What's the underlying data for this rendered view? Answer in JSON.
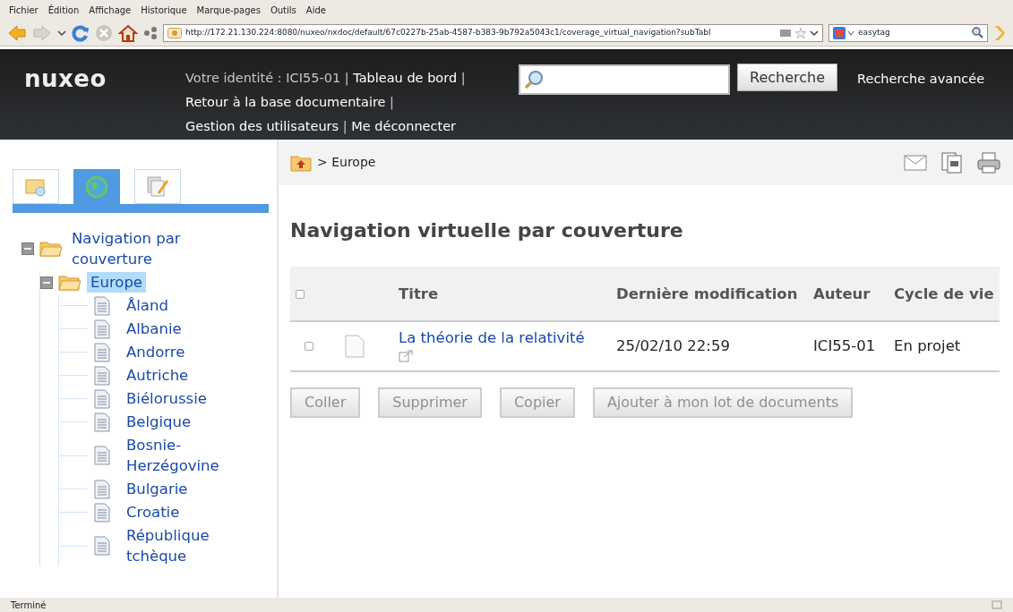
{
  "menu": [
    "Fichier",
    "Édition",
    "Affichage",
    "Historique",
    "Marque-pages",
    "Outils",
    "Aide"
  ],
  "browser": {
    "url": "http://172.21.130.224:8080/nuxeo/nxdoc/default/67c0227b-25ab-4587-b383-9b792a5043c1/coverage_virtual_navigation?subTabl",
    "search_value": "easytag"
  },
  "header": {
    "logo": "nuxeo",
    "identity": "Votre identité : ICI55-01",
    "separator": "|",
    "links": [
      "Tableau de bord",
      "Retour à la base documentaire",
      "Gestion des utilisateurs",
      "Me déconnecter"
    ],
    "search_button": "Recherche",
    "advanced_search": "Recherche avancée"
  },
  "sidebar": {
    "tabs": [
      {
        "kind": "search",
        "selected": false
      },
      {
        "kind": "globe",
        "selected": true
      },
      {
        "kind": "clipboard",
        "selected": false
      }
    ],
    "tree": [
      {
        "label": "Navigation par couverture",
        "kind": "folder",
        "expanded": true,
        "selected": false,
        "children": [
          {
            "label": "Europe",
            "kind": "folder",
            "expanded": true,
            "selected": true,
            "children": [
              {
                "label": "Åland",
                "kind": "document",
                "selected": false
              },
              {
                "label": "Albanie",
                "kind": "document",
                "selected": false
              },
              {
                "label": "Andorre",
                "kind": "document",
                "selected": false
              },
              {
                "label": "Autriche",
                "kind": "document",
                "selected": false
              },
              {
                "label": "Biélorussie",
                "kind": "document",
                "selected": false
              },
              {
                "label": "Belgique",
                "kind": "document",
                "selected": false
              },
              {
                "label": "Bosnie-Herzégovine",
                "kind": "document",
                "selected": false
              },
              {
                "label": "Bulgarie",
                "kind": "document",
                "selected": false
              },
              {
                "label": "Croatie",
                "kind": "document",
                "selected": false
              },
              {
                "label": "République tchèque",
                "kind": "document",
                "selected": false
              }
            ]
          }
        ]
      }
    ]
  },
  "breadcrumb": "> Europe",
  "page_title": "Navigation virtuelle par couverture",
  "table": {
    "select_all_checked": false,
    "columns": [
      "Titre",
      "Dernière modification",
      "Auteur",
      "Cycle de vie"
    ],
    "rows": [
      {
        "checked": false,
        "title": "La théorie de la relativité",
        "modified": "25/02/10 22:59",
        "author": "ICI55-01",
        "lifecycle": "En projet"
      }
    ]
  },
  "actions": [
    {
      "label": "Coller",
      "disabled": true
    },
    {
      "label": "Supprimer",
      "disabled": true
    },
    {
      "label": "Copier",
      "disabled": true
    },
    {
      "label": "Ajouter à mon lot de documents",
      "disabled": true
    }
  ],
  "status_bar": "Terminé"
}
